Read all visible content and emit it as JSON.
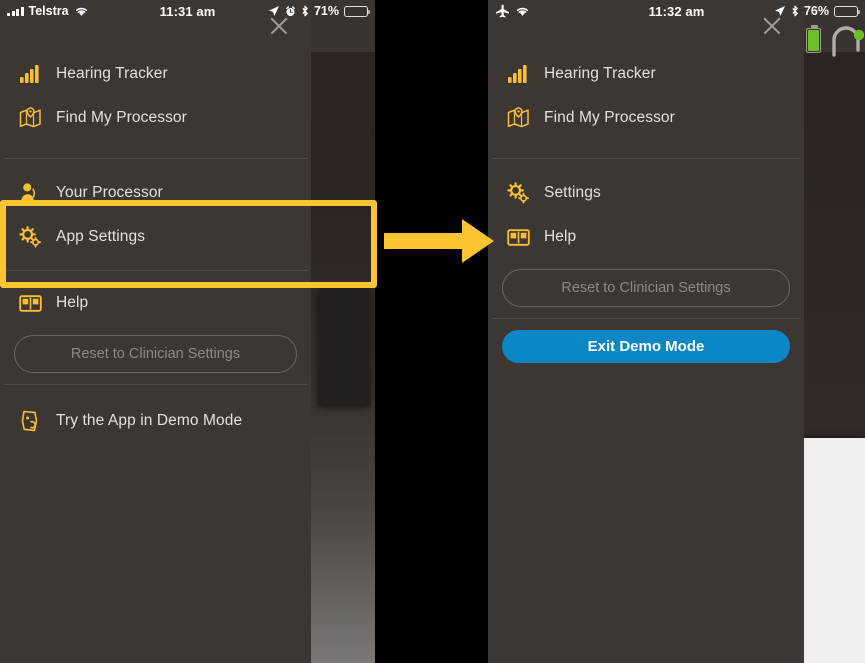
{
  "annotation": {
    "color": "#fcc430",
    "arrow_name": "right-arrow",
    "highlight_name": "highlight-box"
  },
  "left_screen": {
    "status_bar": {
      "carrier": "Telstra",
      "signal_icon": "signal-bars-icon",
      "wifi_icon": "wifi-icon",
      "time": "11:31 am",
      "location_icon": "location-arrow-icon",
      "alarm_icon": "alarm-clock-icon",
      "bluetooth_icon": "bluetooth-icon",
      "battery_percent": "71%",
      "battery_icon": "battery-icon",
      "battery_level": 71
    },
    "drawer": {
      "close_icon": "close-icon",
      "items": [
        {
          "label": "Hearing Tracker",
          "icon": "hearing-tracker-icon"
        },
        {
          "label": "Find My Processor",
          "icon": "find-my-processor-icon"
        },
        {
          "label": "Your Processor",
          "icon": "your-processor-icon"
        },
        {
          "label": "App Settings",
          "icon": "app-settings-icon"
        },
        {
          "label": "Help",
          "icon": "help-book-icon"
        },
        {
          "label": "Try the App in Demo Mode",
          "icon": "demo-mode-icon"
        }
      ],
      "reset_button": "Reset to Clinician Settings"
    }
  },
  "right_screen": {
    "status_bar": {
      "airplane_icon": "airplane-mode-icon",
      "wifi_icon": "wifi-icon",
      "time": "11:32 am",
      "location_icon": "location-arrow-icon",
      "bluetooth_icon": "bluetooth-icon",
      "battery_percent": "76%",
      "battery_icon": "battery-icon",
      "battery_level": 76
    },
    "backdrop": {
      "processor_battery_icon": "processor-battery-icon",
      "processor_icon": "sound-processor-icon"
    },
    "drawer": {
      "close_icon": "close-icon",
      "items": [
        {
          "label": "Hearing Tracker",
          "icon": "hearing-tracker-icon"
        },
        {
          "label": "Find My Processor",
          "icon": "find-my-processor-icon"
        },
        {
          "label": "Settings",
          "icon": "app-settings-icon"
        },
        {
          "label": "Help",
          "icon": "help-book-icon"
        }
      ],
      "reset_button": "Reset to Clinician Settings",
      "exit_demo_button": "Exit Demo Mode"
    }
  }
}
